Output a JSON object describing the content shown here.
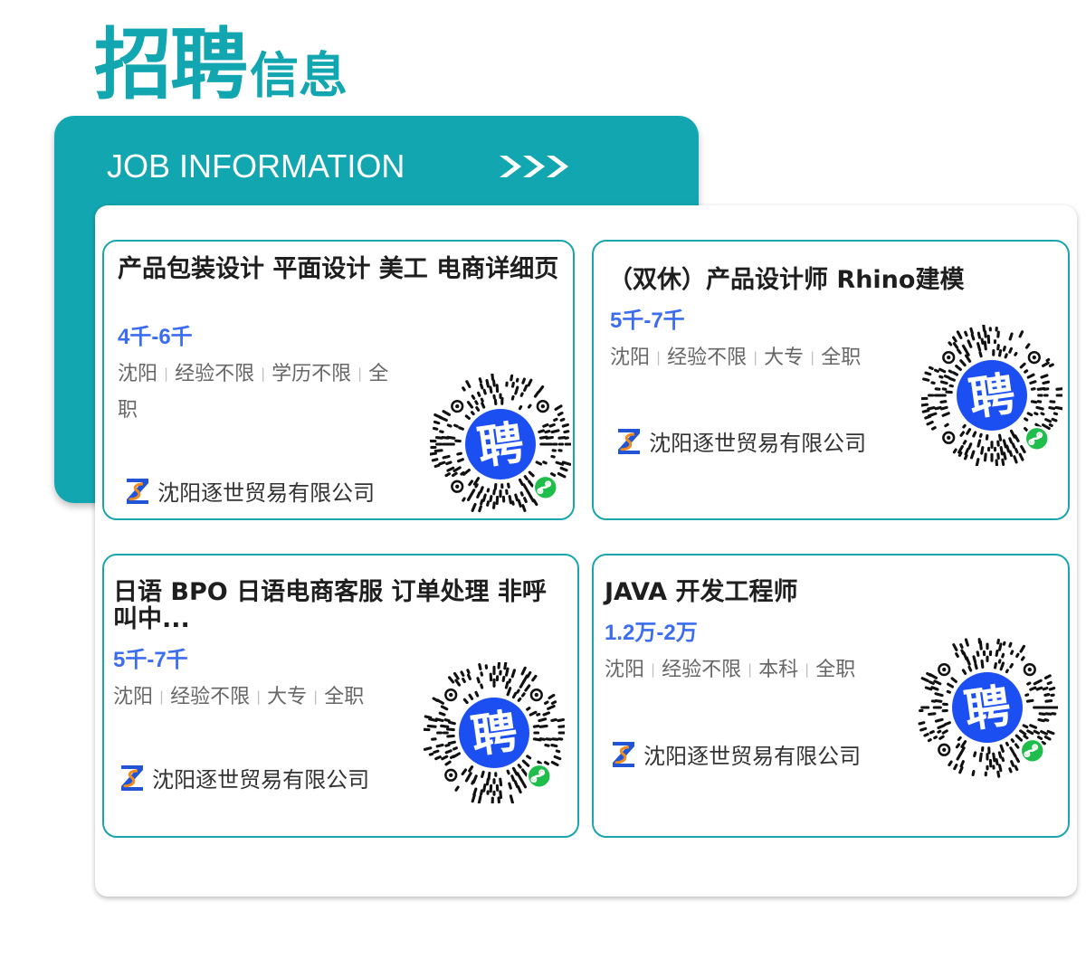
{
  "header": {
    "title_main": "招聘",
    "title_sub": "信息",
    "subtitle": "JOB INFORMATION"
  },
  "colors": {
    "accent": "#12a6b1",
    "salary": "#3c6df0",
    "qr_center": "#1b4ff2",
    "miniprogram_badge": "#1fbe4c"
  },
  "jobs": [
    {
      "title": "产品包装设计 平面设计 美工 电商详细页",
      "salary": "4千-6千",
      "tags": [
        "沈阳",
        "经验不限",
        "学历不限",
        "全职"
      ],
      "company": "沈阳逐世贸易有限公司",
      "qr_char": "聘"
    },
    {
      "title": "（双休）产品设计师 Rhino建模",
      "salary": "5千-7千",
      "tags": [
        "沈阳",
        "经验不限",
        "大专",
        "全职"
      ],
      "company": "沈阳逐世贸易有限公司",
      "qr_char": "聘"
    },
    {
      "title": "日语 BPO 日语电商客服 订单处理 非呼叫中...",
      "salary": "5千-7千",
      "tags": [
        "沈阳",
        "经验不限",
        "大专",
        "全职"
      ],
      "company": "沈阳逐世贸易有限公司",
      "qr_char": "聘"
    },
    {
      "title": "JAVA 开发工程师",
      "salary": "1.2万-2万",
      "tags": [
        "沈阳",
        "经验不限",
        "本科",
        "全职"
      ],
      "company": "沈阳逐世贸易有限公司",
      "qr_char": "聘"
    }
  ]
}
